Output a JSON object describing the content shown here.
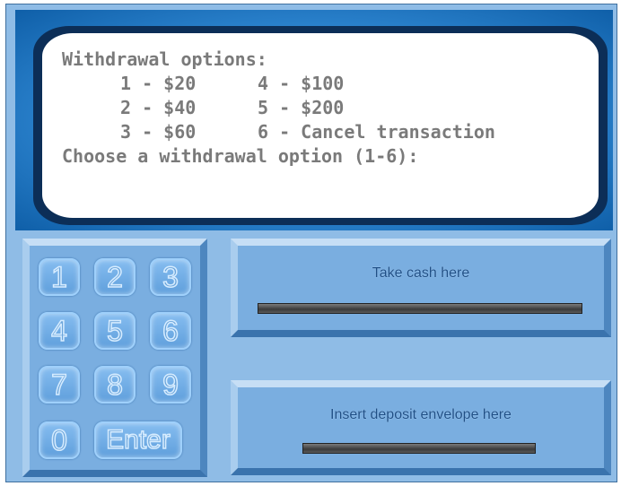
{
  "screen": {
    "title": "Withdrawal options:",
    "options": [
      {
        "left": "1 - $20",
        "right": "4 - $100"
      },
      {
        "left": "2 - $40",
        "right": "5 - $200"
      },
      {
        "left": "3 - $60",
        "right": "6 - Cancel transaction"
      }
    ],
    "prompt": "Choose a withdrawal option (1-6):"
  },
  "keypad": {
    "keys": [
      "1",
      "2",
      "3",
      "4",
      "5",
      "6",
      "7",
      "8",
      "9",
      "0"
    ],
    "enter": "Enter"
  },
  "cash_slot": {
    "label": "Take cash here"
  },
  "deposit_slot": {
    "label": "Insert deposit envelope here"
  },
  "colors": {
    "panel": "#8fbce6",
    "screen_text": "#7a7a7a",
    "slot_label": "#1f4f86"
  }
}
